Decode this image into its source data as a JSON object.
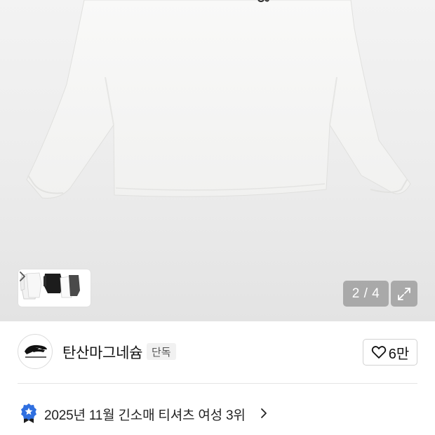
{
  "gallery": {
    "current_page": 2,
    "total_pages": 4,
    "counter_text": "2 / 4",
    "thumbnails": [
      "white-tee-thumb",
      "black-tee-thumb",
      "charcoal-tee-thumb"
    ],
    "icons": {
      "expand": "expand-arrows-icon",
      "thumb_next": "chevron-right-icon"
    }
  },
  "brand": {
    "name": "탄산마그네슘",
    "badge": "단독",
    "logo_icon": "brand-logo-icon",
    "logo_text": "tansanmagnesium"
  },
  "like": {
    "count_label": "6만",
    "icon": "heart-icon"
  },
  "ranking": {
    "text": "2025년 11월 긴소매 티셔츠 여성 3위",
    "icon": "ranking-medal-icon",
    "chevron_icon": "chevron-right-icon"
  },
  "colors": {
    "accent_blue": "#2f6fe0",
    "badge_bg": "#f1f1f1",
    "overlay_gray": "#8a8a8a"
  }
}
